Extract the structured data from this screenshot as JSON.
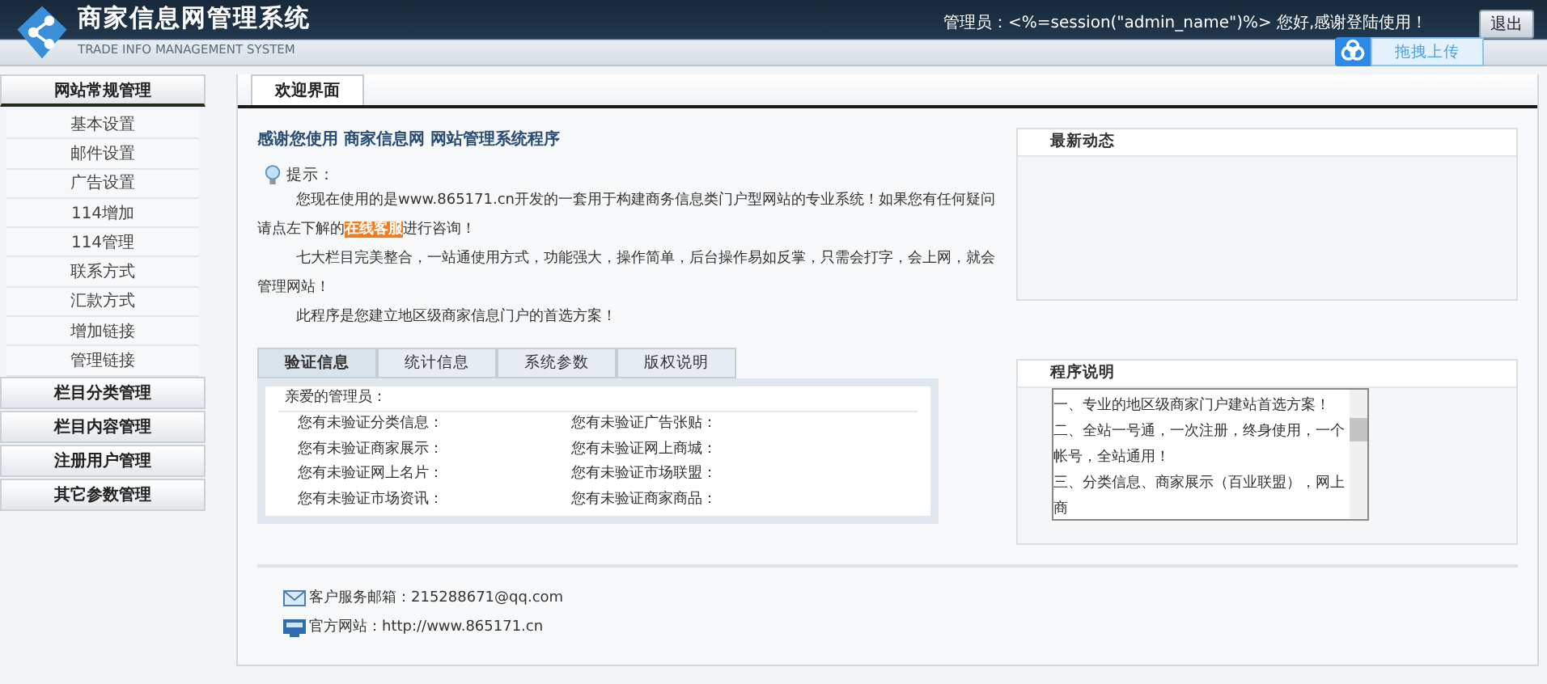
{
  "header": {
    "title": "商家信息网管理系统",
    "subtitle": "TRADE INFO MANAGEMENT SYSTEM",
    "welcome": "管理员：<%=session(\"admin_name\")%> 您好,感谢登陆使用！",
    "logout": "退出",
    "upload": "拖拽上传"
  },
  "sidebar": {
    "groups": [
      {
        "label": "网站常规管理",
        "expanded": true,
        "items": [
          "基本设置",
          "邮件设置",
          "广告设置",
          "114增加",
          "114管理",
          "联系方式",
          "汇款方式",
          "增加链接",
          "管理链接"
        ]
      },
      {
        "label": "栏目分类管理",
        "expanded": false
      },
      {
        "label": "栏目内容管理",
        "expanded": false
      },
      {
        "label": "注册用户管理",
        "expanded": false
      },
      {
        "label": "其它参数管理",
        "expanded": false
      }
    ]
  },
  "tabs": [
    {
      "label": "欢迎界面",
      "selected": true
    }
  ],
  "welcome": {
    "title": "感谢您使用 商家信息网 网站管理系统程序",
    "tip_label": "提示：",
    "paragraphs": [
      "您现在使用的是www.865171.cn开发的一套用于构建商务信息类门户型网站的专业系统！如果您有任何疑问请点左下解的**在线客服**进行咨询！",
      "七大栏目完美整合，一站通使用方式，功能强大，操作简单，后台操作易如反掌，只需会打字，会上网，就会管理网站！",
      "此程序是您建立地区级商家信息门户的首选方案！"
    ]
  },
  "info_tabs": [
    {
      "label": "验证信息",
      "selected": true
    },
    {
      "label": "统计信息",
      "selected": false
    },
    {
      "label": "系统参数",
      "selected": false
    },
    {
      "label": "版权说明",
      "selected": false
    }
  ],
  "verify": {
    "greeting": "亲爱的管理员：",
    "rows": [
      [
        "您有未验证分类信息：",
        "您有未验证广告张贴："
      ],
      [
        "您有未验证商家展示：",
        "您有未验证网上商城："
      ],
      [
        "您有未验证网上名片：",
        "您有未验证市场联盟："
      ],
      [
        "您有未验证市场资讯：",
        "您有未验证商家商品："
      ]
    ]
  },
  "news": {
    "title": "最新动态"
  },
  "about": {
    "title": "程序说明",
    "lines": [
      "一、专业的地区级商家门户建站首选方案！",
      "二、全站一号通，一次注册，终身使用，一个帐号，全站通用！",
      "三、分类信息、商家展示（百业联盟），网上商"
    ]
  },
  "footer": {
    "email": "客户服务邮箱：215288671@qq.com",
    "website": "官方网站：http://www.865171.cn"
  }
}
